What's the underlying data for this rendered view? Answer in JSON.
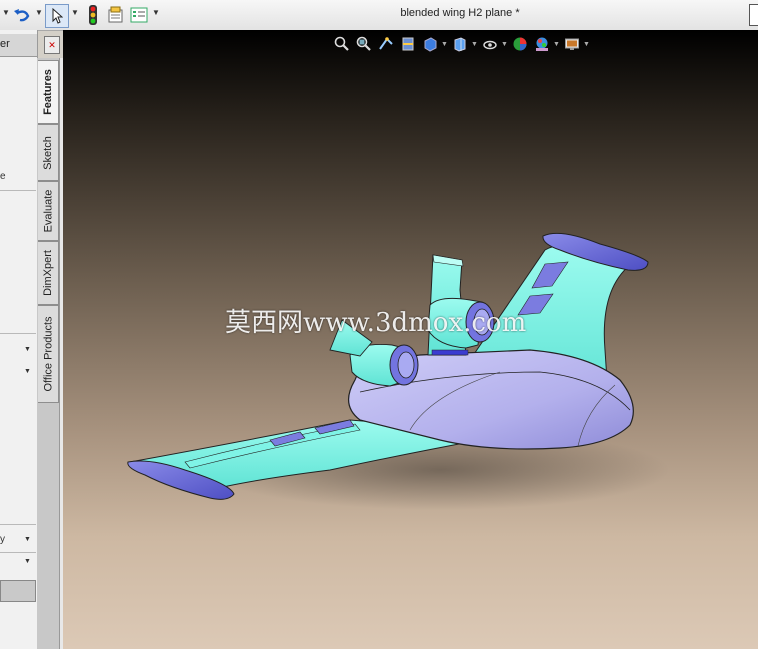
{
  "window": {
    "title": "blended wing H2 plane *"
  },
  "toolbar": {
    "undo_icon": "undo-icon",
    "select_icon": "cursor-arrow-icon",
    "traffic_light_icon": "rebuild-traffic-light-icon",
    "file_properties_icon": "file-properties-icon",
    "options_icon": "options-icon"
  },
  "panel": {
    "header_fragment": "er",
    "fragment_1": "e",
    "fragment_2": "y",
    "tabs": [
      {
        "label": "Features",
        "active": true
      },
      {
        "label": "Sketch",
        "active": false
      },
      {
        "label": "Evaluate",
        "active": false
      },
      {
        "label": "DimXpert",
        "active": false
      },
      {
        "label": "Office Products",
        "active": false
      }
    ]
  },
  "heads_up_toolbar": {
    "icons": [
      "zoom-to-fit-icon",
      "zoom-to-area-icon",
      "previous-view-icon",
      "section-view-icon",
      "view-orientation-icon",
      "display-style-icon",
      "hide-show-icon",
      "edit-appearance-icon",
      "apply-scene-icon",
      "view-settings-icon"
    ]
  },
  "watermark": "莫西网www.3dmox.com",
  "colors": {
    "wing_cyan": "#7ff3e6",
    "body_lavender": "#b9b6ef",
    "tip_purple": "#6a6bd6",
    "viewport_top": "#000000",
    "viewport_bottom": "#dcc9b6"
  }
}
